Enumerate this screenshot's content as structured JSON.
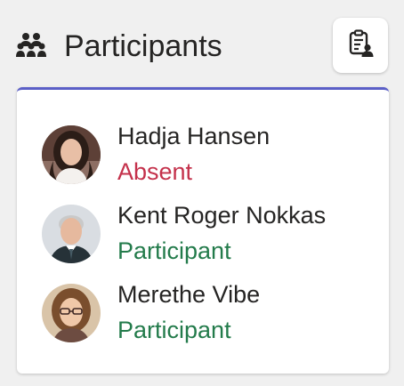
{
  "header": {
    "title": "Participants",
    "people_icon": "people-group-icon",
    "action_icon": "clipboard-person-icon"
  },
  "participants": [
    {
      "name": "Hadja Hansen",
      "role": "Absent"
    },
    {
      "name": "Kent Roger Nokkas",
      "role": "Participant"
    },
    {
      "name": "Merethe Vibe",
      "role": "Participant"
    }
  ],
  "colors": {
    "accent": "#5b5fc7",
    "absent": "#c4314b",
    "participant": "#237b4b",
    "text": "#252423"
  }
}
